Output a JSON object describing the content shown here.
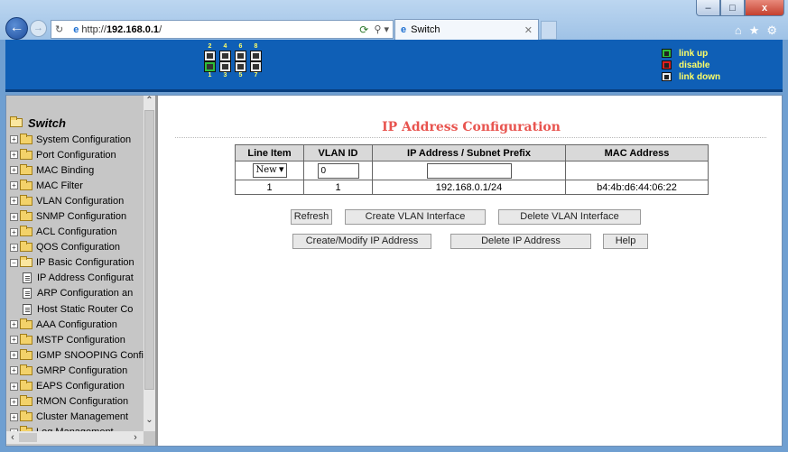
{
  "browser": {
    "url_prefix": "http://",
    "url_host": "192.168.0.1",
    "url_suffix": "/",
    "tab_title": "Switch",
    "win_min": "–",
    "win_max": "□",
    "win_close": "x"
  },
  "banner": {
    "port_top_numbers": [
      "2",
      "4",
      "6",
      "8"
    ],
    "port_bottom_numbers": [
      "1",
      "3",
      "5",
      "7"
    ],
    "legend": [
      {
        "label": "link up",
        "color": "#2fbf3a"
      },
      {
        "label": "disable",
        "color": "#e02020"
      },
      {
        "label": "link down",
        "color": "#eaeaea"
      }
    ]
  },
  "sidebar": {
    "root": "Switch",
    "items": [
      "System Configuration",
      "Port Configuration",
      "MAC Binding",
      "MAC Filter",
      "VLAN Configuration",
      "SNMP Configuration",
      "ACL Configuration",
      "QOS Configuration",
      "IP Basic Configuration",
      "AAA Configuration",
      "MSTP Configuration",
      "IGMP SNOOPING Confi",
      "GMRP Configuration",
      "EAPS Configuration",
      "RMON Configuration",
      "Cluster Management",
      "Log Management"
    ],
    "children": [
      "IP Address Configurat",
      "ARP Configuration an",
      "Host Static Router Co"
    ]
  },
  "main": {
    "title": "IP Address Configuration",
    "headers": [
      "Line Item",
      "VLAN ID",
      "IP Address / Subnet Prefix",
      "MAC Address"
    ],
    "new_row": {
      "select": "New",
      "vlan_value": "0",
      "ip_value": ""
    },
    "rows": [
      {
        "line": "1",
        "vlan": "1",
        "ip": "192.168.0.1/24",
        "mac": "b4:4b:d6:44:06:22"
      }
    ],
    "buttons": {
      "refresh": "Refresh",
      "create_vlan": "Create VLAN Interface",
      "delete_vlan": "Delete VLAN Interface",
      "create_modify_ip": "Create/Modify IP Address",
      "delete_ip": "Delete IP Address",
      "help": "Help"
    }
  },
  "colors": {
    "banner": "#0f5fb6",
    "title": "#e8544f",
    "legend_text": "#ffff66"
  }
}
